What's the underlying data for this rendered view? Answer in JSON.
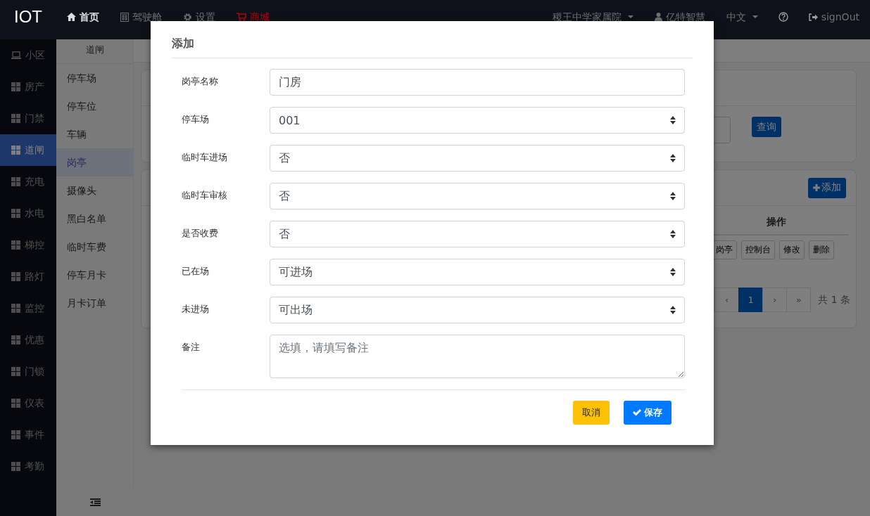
{
  "brand": "IOT",
  "nav": [
    {
      "label": "首页",
      "color": "#dddddd"
    },
    {
      "label": "驾驶舱",
      "color": "#707070"
    },
    {
      "label": "设置",
      "color": "#707070"
    },
    {
      "label": "商城",
      "color": "#c00000"
    }
  ],
  "nav_right": {
    "community": "稷王中学家属院",
    "user": "亿特智慧",
    "language": "中文",
    "sign_out": "signOut"
  },
  "sidebar": [
    {
      "label": "小区",
      "selected": false
    },
    {
      "label": "房产",
      "selected": false
    },
    {
      "label": "门禁",
      "selected": false
    },
    {
      "label": "道闸",
      "selected": true
    },
    {
      "label": "充电",
      "selected": false
    },
    {
      "label": "水电",
      "selected": false
    },
    {
      "label": "梯控",
      "selected": false
    },
    {
      "label": "路灯",
      "selected": false
    },
    {
      "label": "监控",
      "selected": false
    },
    {
      "label": "优惠",
      "selected": false
    },
    {
      "label": "门锁",
      "selected": false
    },
    {
      "label": "仪表",
      "selected": false
    },
    {
      "label": "事件",
      "selected": false
    },
    {
      "label": "考勤",
      "selected": false
    }
  ],
  "subnav": {
    "title": "道闸",
    "items": [
      {
        "label": "停车场",
        "selected": false
      },
      {
        "label": "停车位",
        "selected": false
      },
      {
        "label": "车辆",
        "selected": false
      },
      {
        "label": "岗亭",
        "selected": true
      },
      {
        "label": "摄像头",
        "selected": false
      },
      {
        "label": "黑白名单",
        "selected": false
      },
      {
        "label": "临时车费",
        "selected": false
      },
      {
        "label": "停车月卡",
        "selected": false
      },
      {
        "label": "月卡订单",
        "selected": false
      }
    ]
  },
  "query_button": "查询",
  "add_button": "添加",
  "table": {
    "columns": [
      "操作"
    ],
    "row_actions": [
      "岗亭",
      "控制台",
      "修改",
      "删除"
    ]
  },
  "pagination": {
    "pages": [
      {
        "label": "‹",
        "selected": false
      },
      {
        "label": "1",
        "selected": true
      },
      {
        "label": "›",
        "selected": false
      },
      {
        "label": "»",
        "selected": false
      }
    ],
    "total": "共 1 条"
  },
  "modal": {
    "title": "添加",
    "fields": [
      {
        "label": "岗亭名称",
        "kind": "input",
        "value": "门房"
      },
      {
        "label": "停车场",
        "kind": "select",
        "value": "001"
      },
      {
        "label": "临时车进场",
        "kind": "select",
        "value": "否"
      },
      {
        "label": "临时车审核",
        "kind": "select",
        "value": "否"
      },
      {
        "label": "是否收费",
        "kind": "select",
        "value": "否"
      },
      {
        "label": "已在场",
        "kind": "select",
        "value": "可进场"
      },
      {
        "label": "未进场",
        "kind": "select",
        "value": "可出场"
      },
      {
        "label": "备注",
        "kind": "textarea",
        "placeholder": "选填，请填写备注"
      }
    ],
    "cancel": "取消",
    "save": "保存"
  }
}
